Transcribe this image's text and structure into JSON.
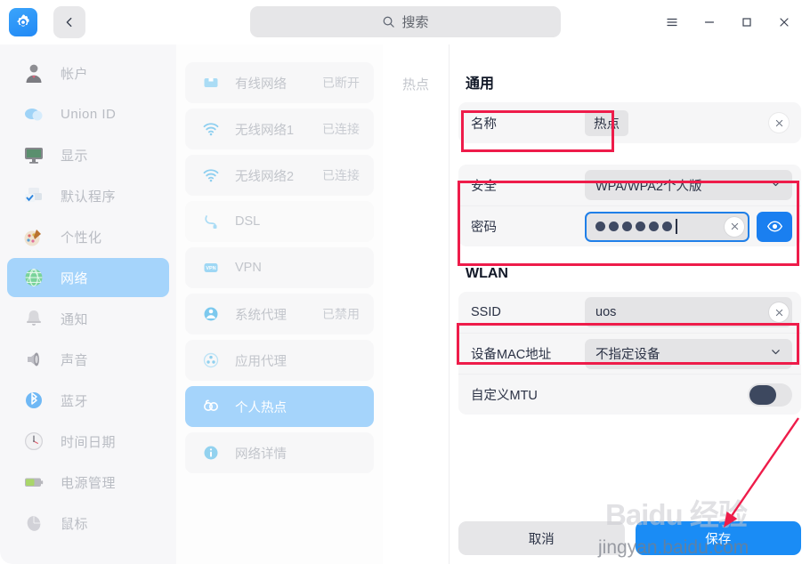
{
  "titlebar": {
    "app_icon": "settings-gear-icon",
    "back_icon": "chevron-left-icon",
    "search_placeholder": "搜索",
    "search_icon": "search-icon",
    "menu_icon": "hamburger-menu-icon",
    "minimize_icon": "minimize-icon",
    "maximize_icon": "maximize-icon",
    "close_icon": "close-icon"
  },
  "sidebar": {
    "items": [
      {
        "label": "帐户",
        "icon": "user-account-icon",
        "active": false
      },
      {
        "label": "Union ID",
        "icon": "cloud-icon",
        "active": false
      },
      {
        "label": "显示",
        "icon": "monitor-icon",
        "active": false
      },
      {
        "label": "默认程序",
        "icon": "default-apps-icon",
        "active": false
      },
      {
        "label": "个性化",
        "icon": "palette-icon",
        "active": false
      },
      {
        "label": "网络",
        "icon": "globe-network-icon",
        "active": true
      },
      {
        "label": "通知",
        "icon": "bell-icon",
        "active": false
      },
      {
        "label": "声音",
        "icon": "speaker-icon",
        "active": false
      },
      {
        "label": "蓝牙",
        "icon": "bluetooth-icon",
        "active": false
      },
      {
        "label": "时间日期",
        "icon": "clock-icon",
        "active": false
      },
      {
        "label": "电源管理",
        "icon": "battery-icon",
        "active": false
      },
      {
        "label": "鼠标",
        "icon": "mouse-icon",
        "active": false
      }
    ]
  },
  "network_list": {
    "items": [
      {
        "label": "有线网络",
        "status": "已断开",
        "icon": "ethernet-icon",
        "active": false
      },
      {
        "label": "无线网络1",
        "status": "已连接",
        "icon": "wifi-icon",
        "active": false
      },
      {
        "label": "无线网络2",
        "status": "已连接",
        "icon": "wifi-icon",
        "active": false
      },
      {
        "label": "DSL",
        "status": "",
        "icon": "dsl-icon",
        "active": false
      },
      {
        "label": "VPN",
        "status": "",
        "icon": "vpn-icon",
        "active": false
      },
      {
        "label": "系统代理",
        "status": "已禁用",
        "icon": "system-proxy-icon",
        "active": false
      },
      {
        "label": "应用代理",
        "status": "",
        "icon": "app-proxy-icon",
        "active": false
      },
      {
        "label": "个人热点",
        "status": "",
        "icon": "hotspot-link-icon",
        "active": true
      },
      {
        "label": "网络详情",
        "status": "",
        "icon": "info-icon",
        "active": false
      }
    ]
  },
  "tabs": {
    "items": [
      {
        "label": "热点"
      }
    ]
  },
  "form": {
    "general": {
      "title": "通用",
      "name_label": "名称",
      "name_value": "热点",
      "security_label": "安全",
      "security_value": "WPA/WPA2个人版",
      "password_label": "密码",
      "password_dots": 6,
      "eye_icon": "eye-visibility-icon",
      "clear_icon": "clear-x-icon",
      "chevron_icon": "chevron-down-icon"
    },
    "wlan": {
      "title": "WLAN",
      "ssid_label": "SSID",
      "ssid_value": "uos",
      "mac_label": "设备MAC地址",
      "mac_value": "不指定设备",
      "mtu_label": "自定义MTU",
      "mtu_enabled": false
    }
  },
  "footer": {
    "cancel_label": "取消",
    "save_label": "保存"
  },
  "watermark": {
    "logo_text": "Baidu 经验",
    "url_text": "jingyan.baidu.com"
  },
  "colors": {
    "accent_blue": "#1a8cf5",
    "selection_blue": "#a5d4fb",
    "highlight_red": "#ee1c4a",
    "field_gray": "#e4e4e6",
    "panel_gray": "#f6f6f7",
    "text_dark": "#2b3245"
  }
}
